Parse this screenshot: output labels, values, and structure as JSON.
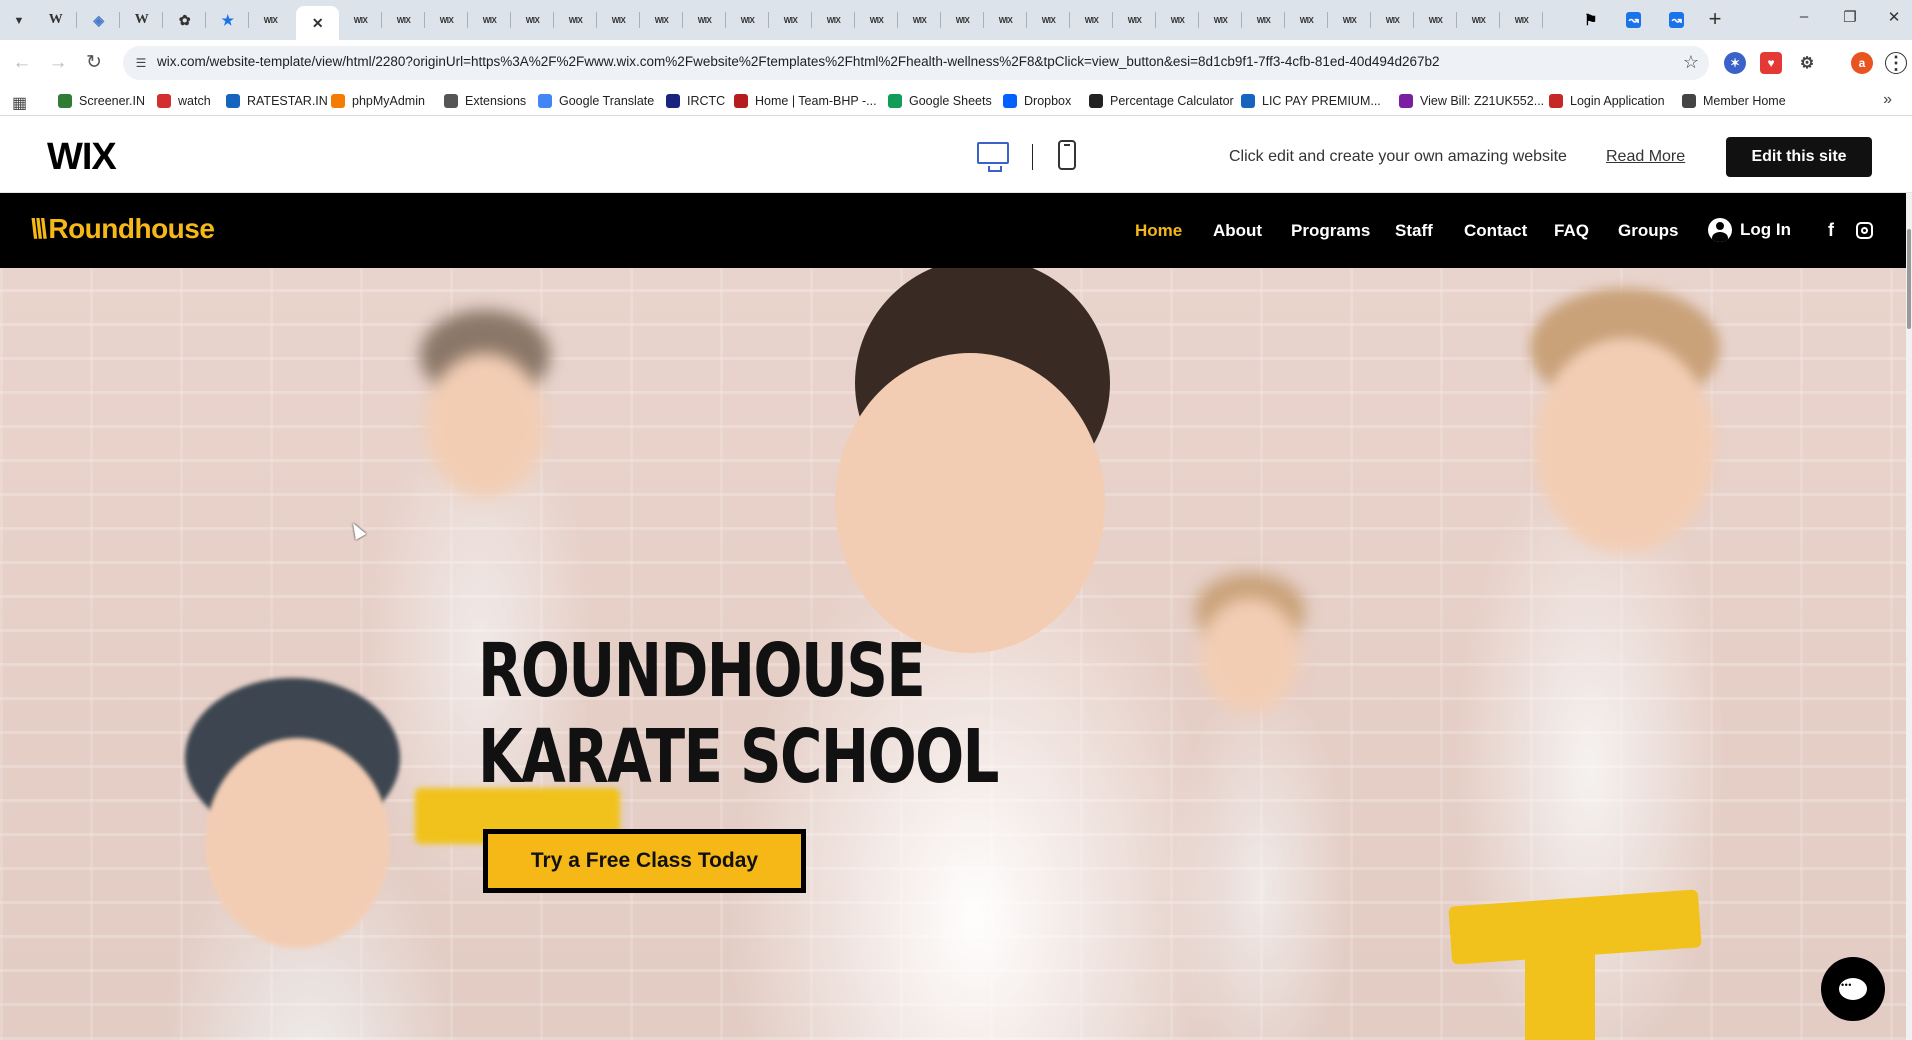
{
  "browser": {
    "tabs": [
      {
        "icon": "wix-icon",
        "label": "WIX"
      },
      {
        "icon": "wikipedia-icon",
        "label": "W"
      }
    ],
    "url": "wix.com/website-template/view/html/2280?originUrl=https%3A%2F%2Fwww.wix.com%2Fwebsite%2Ftemplates%2Fhtml%2Fhealth-wellness%2F8&tpClick=view_button&esi=8d1cb9f1-7ff3-4cfb-81ed-40d494d267b2",
    "profile_initial": "a",
    "bookmarks": [
      {
        "label": "Screener.IN",
        "color": "#2e7d32"
      },
      {
        "label": "watch",
        "color": "#d32f2f"
      },
      {
        "label": "RATESTAR.IN",
        "color": "#1565c0"
      },
      {
        "label": "phpMyAdmin",
        "color": "#f57c00"
      },
      {
        "label": "Extensions",
        "color": "#555555"
      },
      {
        "label": "Google Translate",
        "color": "#4285f4"
      },
      {
        "label": "IRCTC",
        "color": "#1a237e"
      },
      {
        "label": "Home | Team-BHP -...",
        "color": "#b71c1c"
      },
      {
        "label": "Google Sheets",
        "color": "#0f9d58"
      },
      {
        "label": "Dropbox",
        "color": "#0061fe"
      },
      {
        "label": "Percentage Calculator",
        "color": "#222222"
      },
      {
        "label": "LIC PAY PREMIUM...",
        "color": "#1565c0"
      },
      {
        "label": "View Bill: Z21UK552...",
        "color": "#7b1fa2"
      },
      {
        "label": "Login Application",
        "color": "#c62828"
      },
      {
        "label": "Member Home",
        "color": "#444444"
      }
    ]
  },
  "wix_bar": {
    "logo": "WIX",
    "tagline": "Click edit and create your own amazing website",
    "read_more": "Read More",
    "edit_button": "Edit this site"
  },
  "site": {
    "logo_mark": "\\\\\\",
    "logo_text": "Roundhouse",
    "menu": [
      {
        "label": "Home",
        "active": true
      },
      {
        "label": "About",
        "active": false
      },
      {
        "label": "Programs",
        "active": false
      },
      {
        "label": "Staff",
        "active": false
      },
      {
        "label": "Contact",
        "active": false
      },
      {
        "label": "FAQ",
        "active": false
      },
      {
        "label": "Groups",
        "active": false
      }
    ],
    "login_label": "Log In",
    "accent_color": "#f5b816"
  },
  "hero": {
    "title_line1": "ROUNDHOUSE",
    "title_line2": "KARATE SCHOOL",
    "cta_label": "Try a Free Class Today"
  }
}
